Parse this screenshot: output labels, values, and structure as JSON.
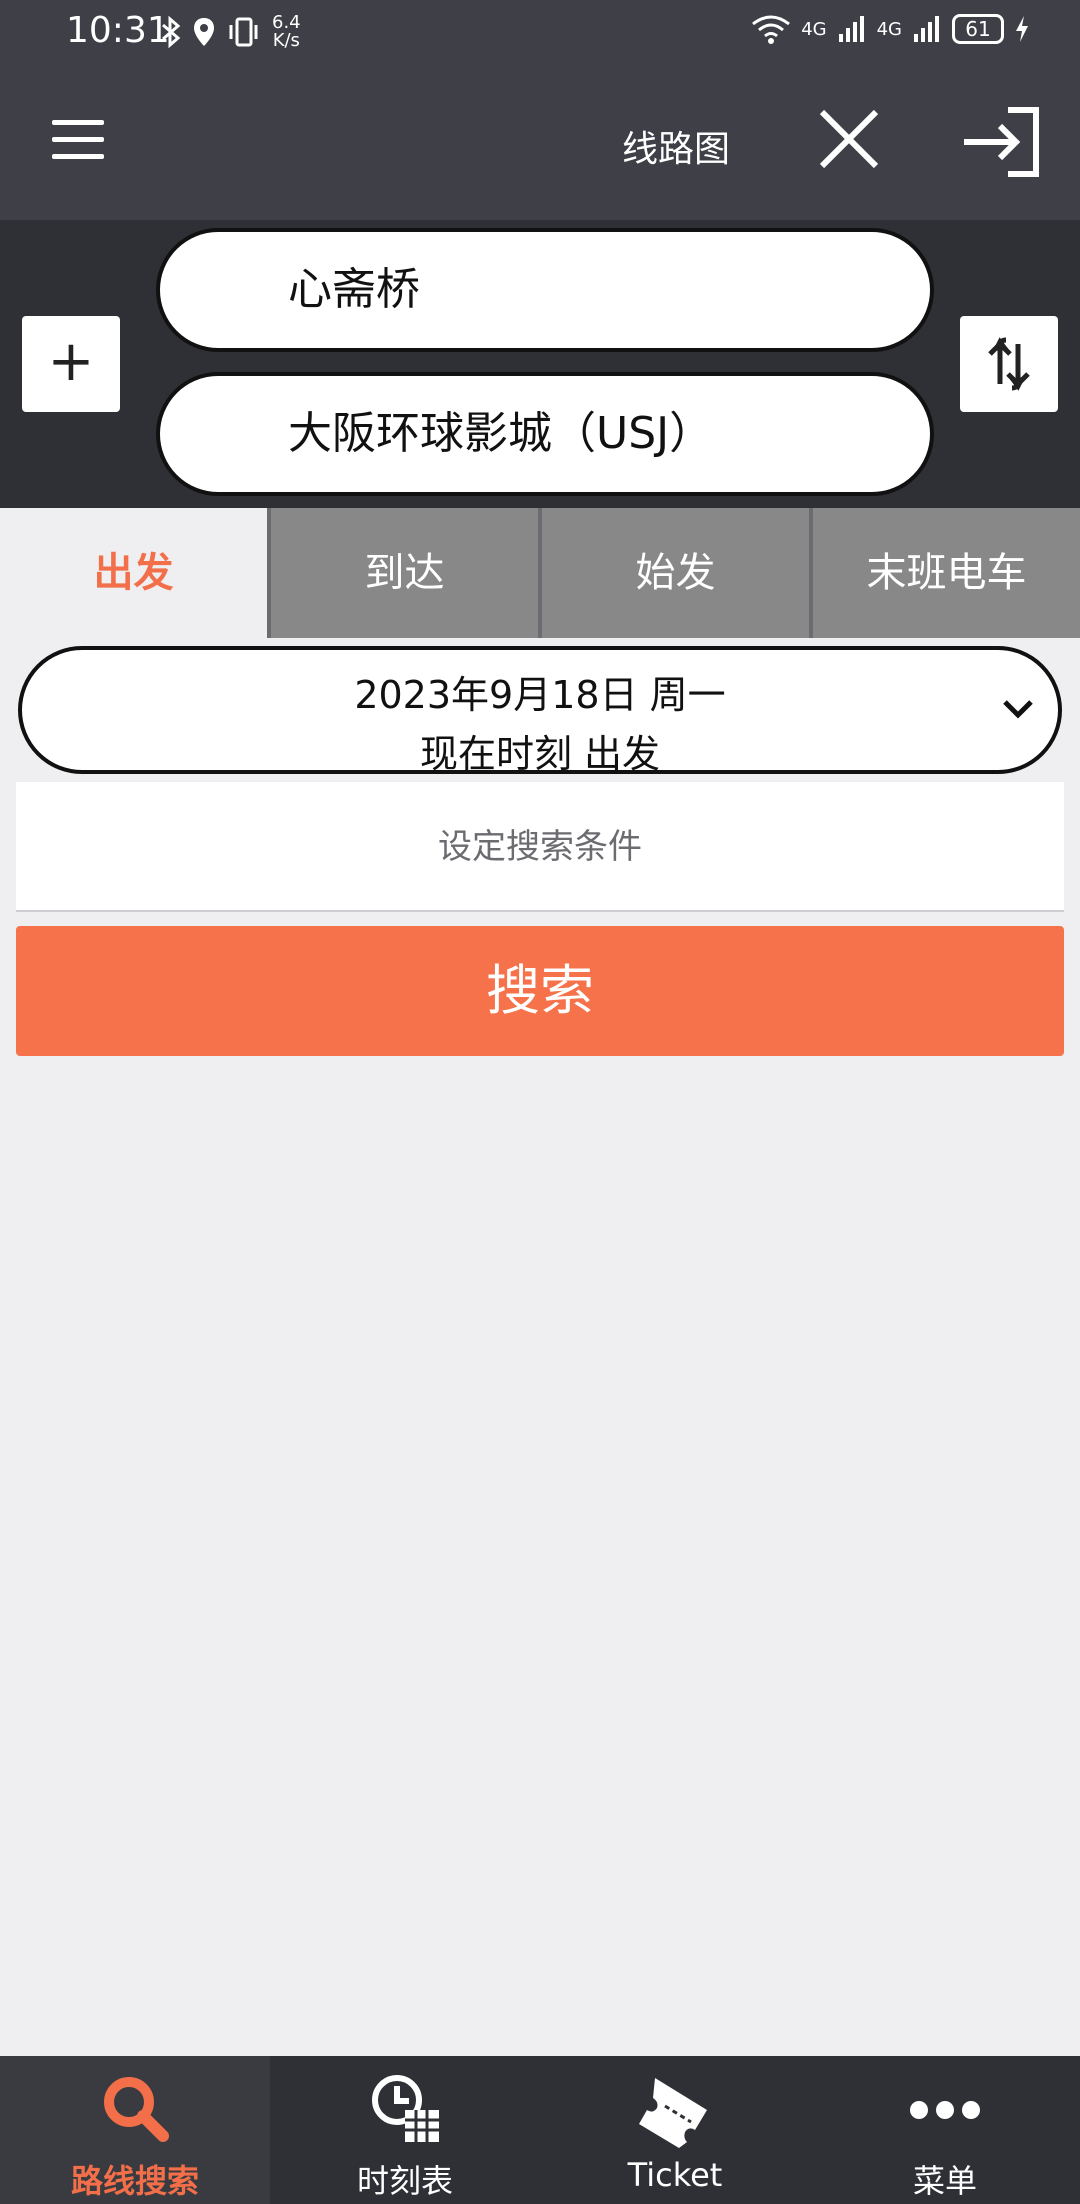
{
  "status_bar": {
    "time": "10:31",
    "net_speed_value": "6.4",
    "net_speed_unit": "K/s",
    "signal_1": "4G",
    "signal_2": "4G",
    "battery": "61"
  },
  "header": {
    "title": "线路图"
  },
  "stations": {
    "from": "心斋桥",
    "to": "大阪环球影城（USJ）"
  },
  "tabs": [
    {
      "label": "出发",
      "active": true
    },
    {
      "label": "到达",
      "active": false
    },
    {
      "label": "始发",
      "active": false
    },
    {
      "label": "末班电车",
      "active": false
    }
  ],
  "date_select": {
    "line1": "2023年9月18日 周一",
    "line2": "现在时刻 出发"
  },
  "conditions": {
    "label": "设定搜索条件"
  },
  "search": {
    "label": "搜索"
  },
  "bottom_nav": [
    {
      "label": "路线搜索",
      "icon": "search-icon",
      "active": true
    },
    {
      "label": "时刻表",
      "icon": "timetable-icon",
      "active": false
    },
    {
      "label": "Ticket",
      "icon": "ticket-icon",
      "active": false
    },
    {
      "label": "菜单",
      "icon": "more-dots-icon",
      "active": false
    }
  ],
  "colors": {
    "accent": "#f5724b",
    "header_bg": "#3e3f47",
    "station_bg": "#2f3035",
    "page_bg": "#efeff1"
  }
}
